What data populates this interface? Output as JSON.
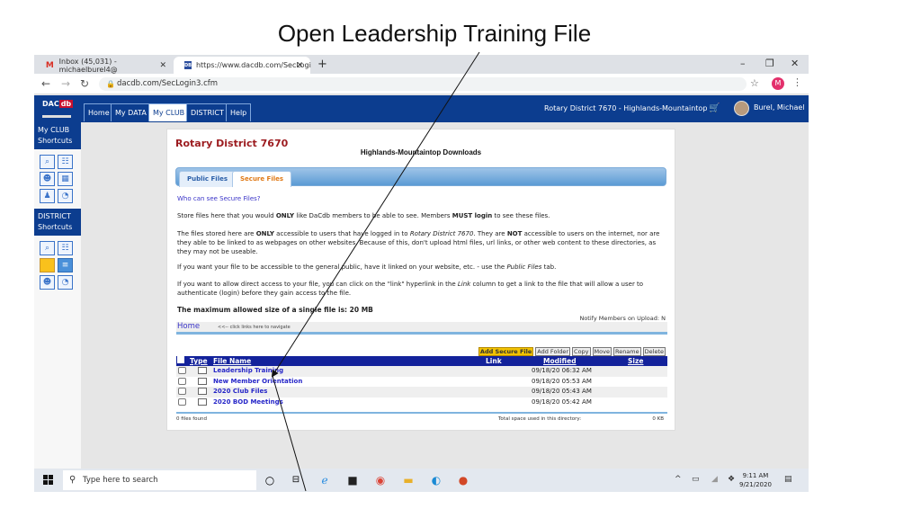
{
  "slide": {
    "title": "Open Leadership Training  File"
  },
  "browser": {
    "tabs": [
      {
        "icon": "gmail-icon",
        "label": "Inbox (45,031) - michaelburel4@",
        "active": false
      },
      {
        "icon": "dacdb-favicon",
        "label": "https://www.dacdb.com/SecLogi",
        "active": true
      }
    ],
    "new_tab": "+",
    "address": "dacdb.com/SecLogin3.cfm",
    "profile_initial": "M",
    "window_controls": {
      "minimize": "–",
      "restore": "❐",
      "close": "✕"
    }
  },
  "site": {
    "logo": {
      "line1": "DAC",
      "line2": "db"
    },
    "nav_tabs": [
      {
        "label": "Home",
        "active": false
      },
      {
        "label": "My DATA",
        "active": false
      },
      {
        "label": "My CLUB",
        "active": true
      },
      {
        "label": "DISTRICT",
        "active": false
      },
      {
        "label": "Help",
        "active": false
      }
    ],
    "org": "Rotary District 7670 - Highlands-Mountaintop",
    "user": "Burel, Michael"
  },
  "sidebar": {
    "club_heading": "My CLUB Shortcuts",
    "district_heading": "DISTRICT Shortcuts",
    "club_icons": [
      "member-search-icon",
      "org-chart-icon",
      "attendance-icon",
      "calendar-icon",
      "runner-icon",
      "clock-icon"
    ],
    "district_icons": [
      "member-search-icon",
      "org-chart-icon",
      "folder-icon",
      "folder-blue-icon",
      "attendance-icon",
      "clock-icon"
    ]
  },
  "main": {
    "district_title": "Rotary District 7670",
    "downloads_title": "Highlands-Mountaintop Downloads",
    "file_tabs": [
      {
        "label": "Public Files",
        "active": false
      },
      {
        "label": "Secure Files",
        "active": true
      }
    ],
    "who_link": "Who can see Secure Files?",
    "p1": "Store files here that you would <b>ONLY</b> like DaCdb members to be able to see. Members <b>MUST login</b> to see these files.",
    "p2": "The files stored here are <b>ONLY</b> accessible to users that have logged in to <i>Rotary District 7670</i>. They are <b>NOT</b> accessible to users on the internet, nor are they able to be linked to as webpages on other websites. Because of this, don't upload html files, url links, or other web content to these directories, as they may not be useable.",
    "p3": "If you want your file to be accessible to the general public, have it linked on your website, etc. - use the <i>Public Files</i> tab.",
    "p4": "If you want to allow direct access to your file, you can click on the \"link\" hyperlink in the <i>Link</i> column to get a link to the file that will allow a user to authenticate (login) before they gain access to the file.",
    "max_size": "The maximum allowed size of a single file is: 20 MB",
    "notify": "Notify Members on Upload: N",
    "home_link": "Home",
    "home_hint": "<<-- click links here to navigate",
    "actions": [
      "Add Secure File",
      "Add Folder",
      "Copy",
      "Move",
      "Rename",
      "Delete"
    ],
    "columns": {
      "type": "Type",
      "name": "File Name",
      "link": "Link",
      "modified": "Modified",
      "size": "Size"
    },
    "rows": [
      {
        "name": "Leadership Training",
        "modified": "09/18/20 06:32 AM"
      },
      {
        "name": "New Member Orientation",
        "modified": "09/18/20 05:53 AM"
      },
      {
        "name": "2020 Club Files",
        "modified": "09/18/20 05:43 AM"
      },
      {
        "name": "2020 BOD Meetings",
        "modified": "09/18/20 05:42 AM"
      }
    ],
    "footer": {
      "found": "0 files found",
      "space_label": "Total space used in this directory:",
      "space_value": "0 KB"
    }
  },
  "taskbar": {
    "search_placeholder": "Type here to search",
    "apps": [
      "cortana-icon",
      "task-view-icon",
      "internet-explorer-icon",
      "store-icon",
      "chrome-icon",
      "file-explorer-icon",
      "edge-icon",
      "powerpoint-icon"
    ],
    "time": "9:11 AM",
    "date": "9/21/2020"
  },
  "colors": {
    "site_blue": "#0c3d8f",
    "table_header": "#13229b",
    "accent_orange": "#e07a17",
    "title_red": "#9c1b1f"
  }
}
